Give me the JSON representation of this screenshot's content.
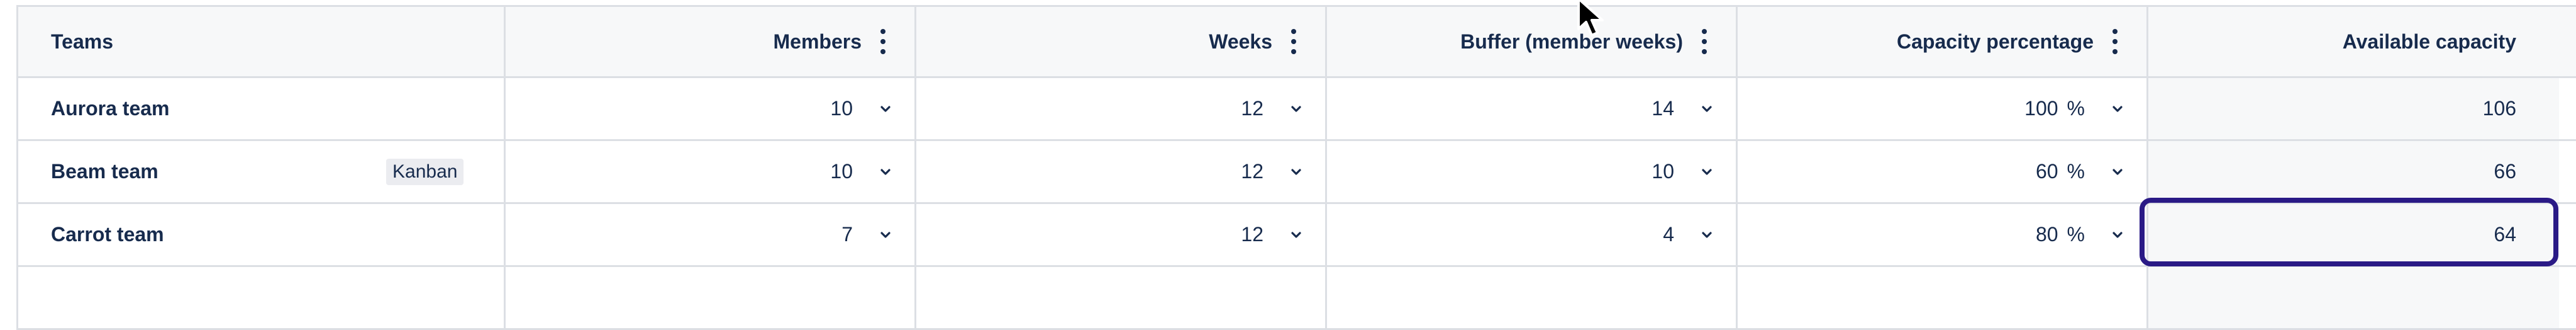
{
  "columns": [
    {
      "label": "Teams"
    },
    {
      "label": "Members"
    },
    {
      "label": "Weeks"
    },
    {
      "label": "Buffer (member weeks)"
    },
    {
      "label": "Capacity percentage"
    },
    {
      "label": "Available capacity"
    }
  ],
  "rows": [
    {
      "team": "Aurora team",
      "badge": "",
      "members": "10",
      "weeks": "12",
      "buffer": "14",
      "capacity_pct": "100",
      "capacity_unit": "%",
      "available": "106"
    },
    {
      "team": "Beam team",
      "badge": "Kanban",
      "members": "10",
      "weeks": "12",
      "buffer": "10",
      "capacity_pct": "60",
      "capacity_unit": "%",
      "available": "66"
    },
    {
      "team": "Carrot team",
      "badge": "",
      "members": "7",
      "weeks": "12",
      "buffer": "4",
      "capacity_pct": "80",
      "capacity_unit": "%",
      "available": "64"
    }
  ],
  "colors": {
    "highlight_border": "#2a1a86",
    "grid": "#dcdfe4",
    "header_bg": "#f7f8f9"
  },
  "icons": {
    "column_menu": "more-vertical-icon",
    "dropdown": "chevron-down-icon",
    "pointer": "mouse-cursor-icon"
  }
}
